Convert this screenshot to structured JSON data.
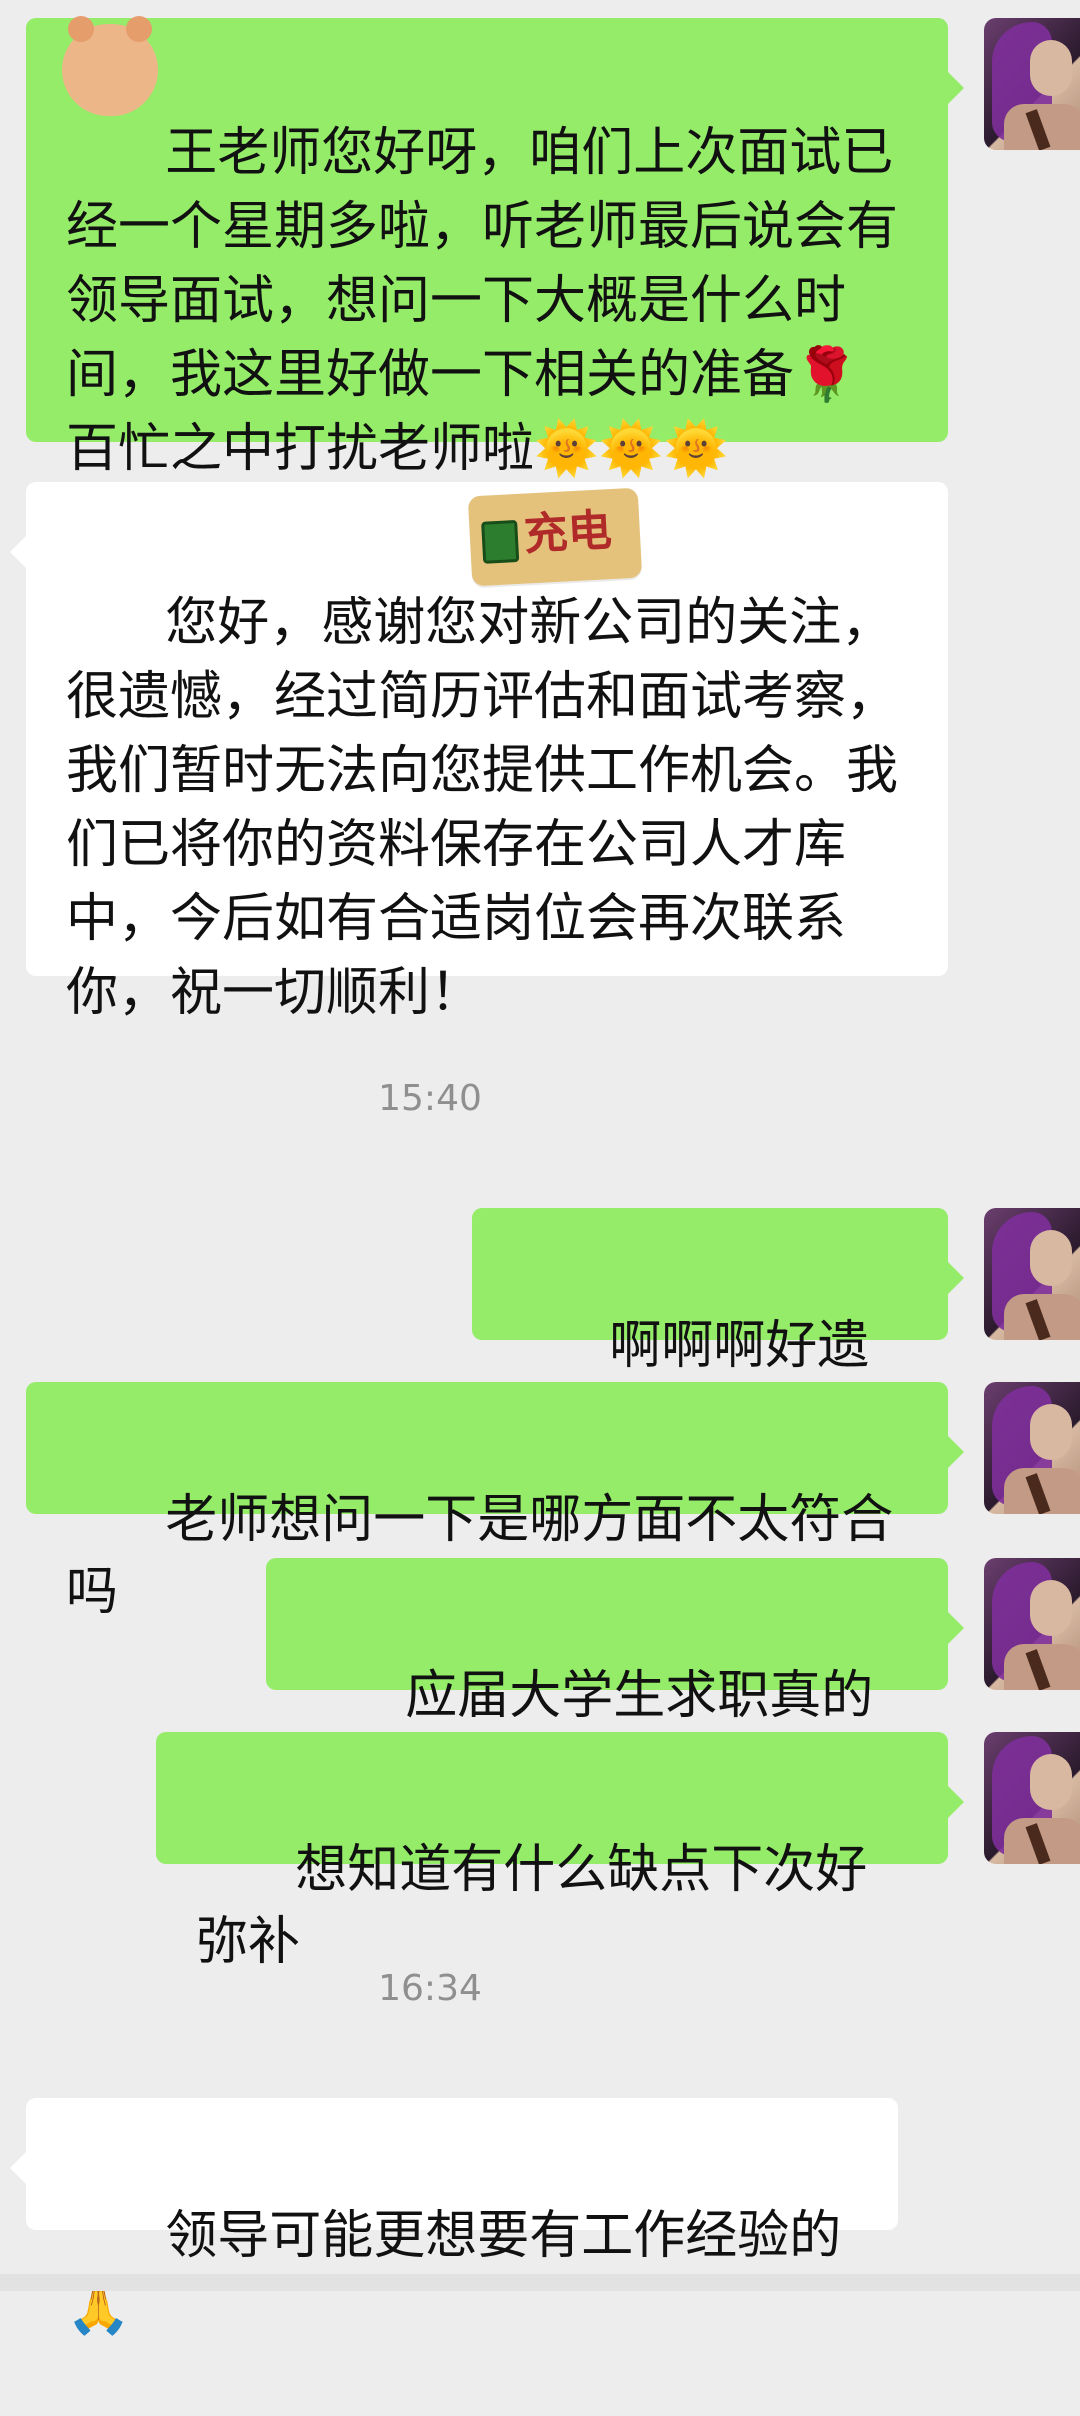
{
  "conversation": {
    "messages": [
      {
        "id": "m1",
        "side": "right",
        "color": "#95ec69",
        "text": "王老师您好呀，咱们上次面试已经一个星期多啦，听老师最后说会有领导面试，想问一下大概是什么时间，我这里好做一下相关的准备🌹百忙之中打扰老师啦🌞🌞🌞"
      },
      {
        "id": "m2",
        "side": "left",
        "color": "#ffffff",
        "text": "您好，感谢您对新公司的关注，很遗憾，经过简历评估和面试考察，我们暂时无法向您提供工作机会。我们已将你的资料保存在公司人才库中，今后如有合适岗位会再次联系你，祝一切顺利！"
      },
      {
        "id": "t1",
        "type": "time",
        "text": "15:40"
      },
      {
        "id": "m3",
        "side": "right",
        "color": "#95ec69",
        "text": "啊啊啊好遗憾😢"
      },
      {
        "id": "m4",
        "side": "right",
        "color": "#95ec69",
        "text": "老师想问一下是哪方面不太符合吗"
      },
      {
        "id": "m5",
        "side": "right",
        "color": "#95ec69",
        "text": "应届大学生求职真的很难"
      },
      {
        "id": "m6",
        "side": "right",
        "color": "#95ec69",
        "text": "想知道有什么缺点下次好弥补"
      },
      {
        "id": "t2",
        "type": "time",
        "text": "16:34"
      },
      {
        "id": "m7",
        "side": "left",
        "color": "#ffffff",
        "text": "领导可能更想要有工作经验的🙏"
      }
    ],
    "redaction_label": "充电",
    "avatar_icon": "user-avatar-icon"
  }
}
